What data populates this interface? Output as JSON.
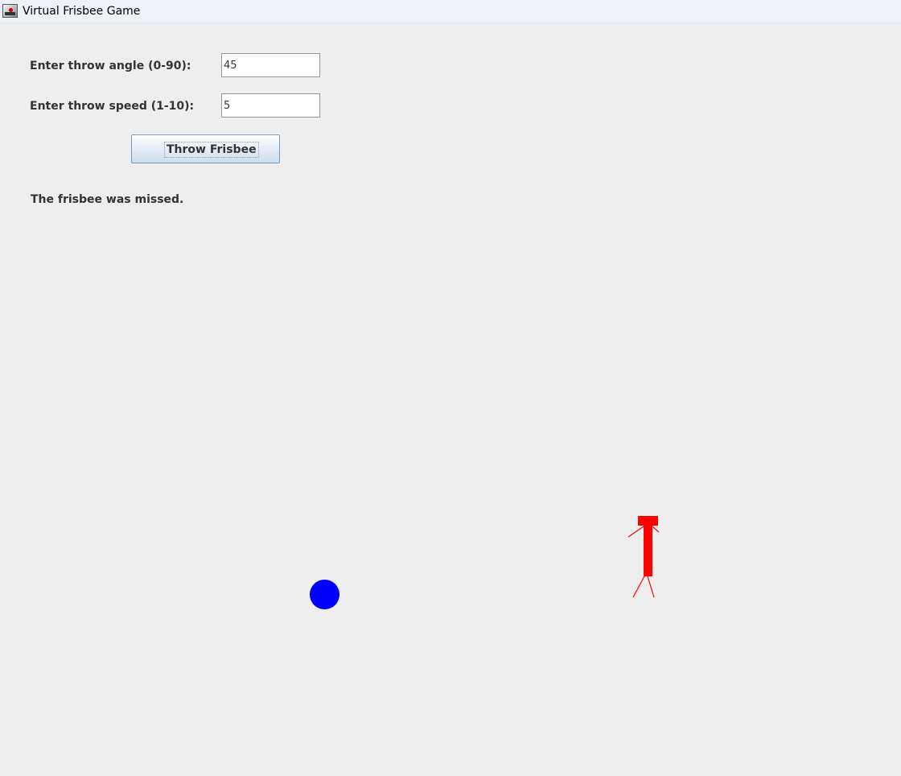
{
  "window": {
    "title": "Virtual Frisbee Game",
    "icon": "java-app-icon"
  },
  "form": {
    "angle_label": "Enter throw angle (0-90):",
    "angle_value": "45",
    "speed_label": "Enter throw speed (1-10):",
    "speed_value": "5",
    "throw_button_label": "Throw Frisbee"
  },
  "status": {
    "message": "The frisbee was missed."
  },
  "scene": {
    "frisbee_color": "#0000ff",
    "player_color": "#ff0000"
  }
}
